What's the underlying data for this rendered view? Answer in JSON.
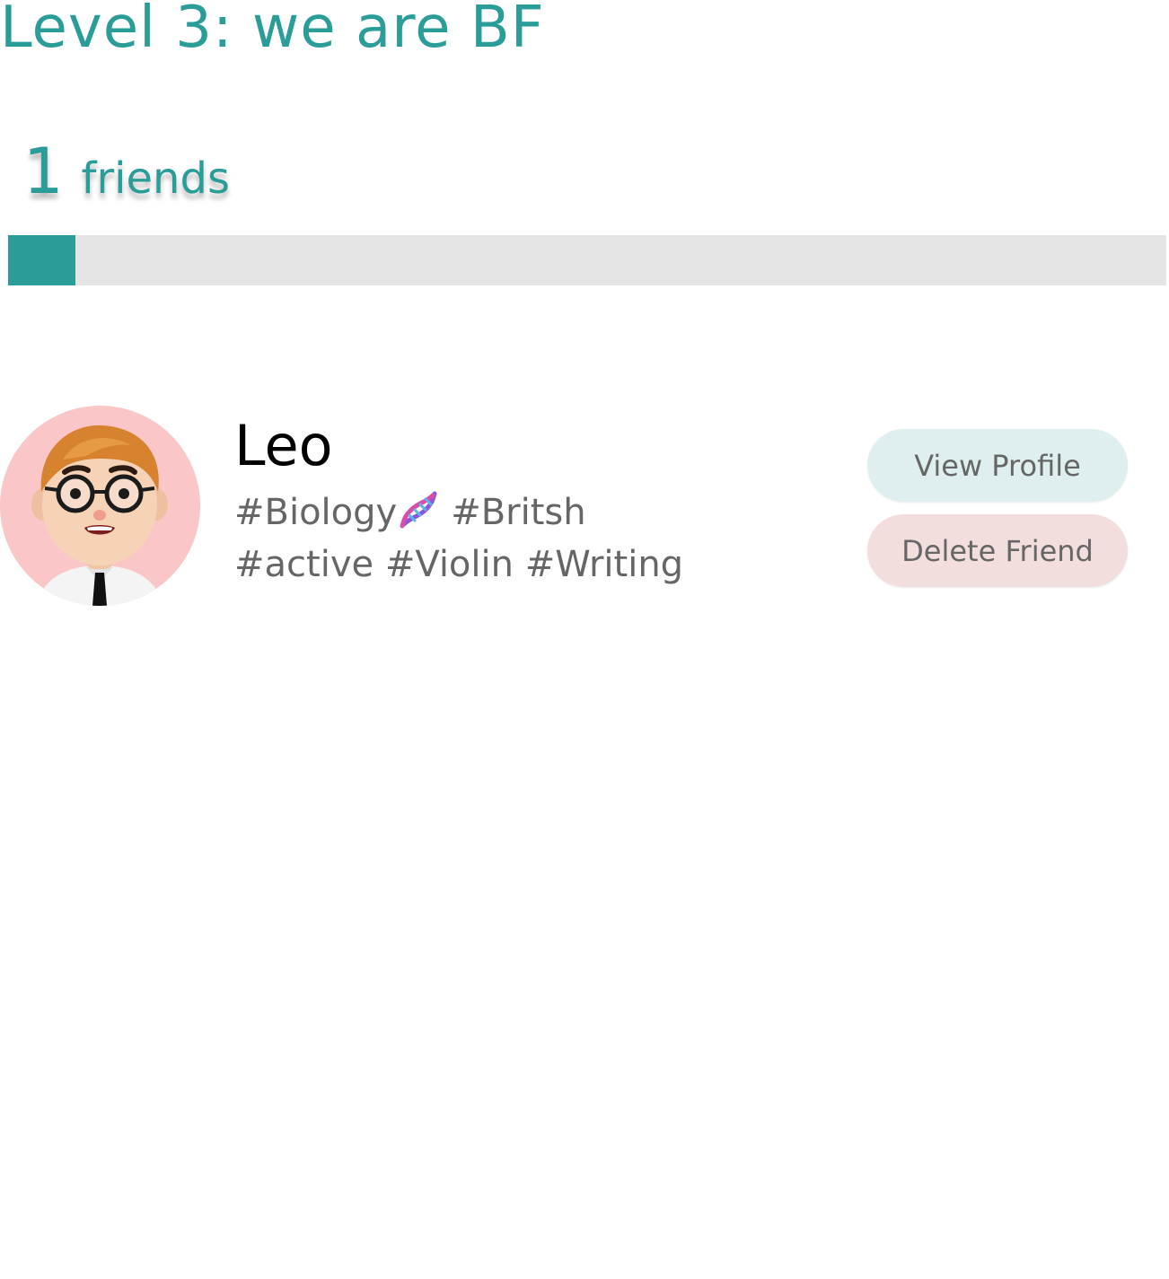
{
  "header": {
    "level_title": "Level 3: we are BF"
  },
  "friends_summary": {
    "count": "1",
    "label": "friends",
    "progress_fraction": 0.058
  },
  "friends": [
    {
      "name": "Leo",
      "tags_line1": "#Biology",
      "tags_line1_icon": "dna-icon",
      "tags_line1_rest": "#Britsh",
      "tags_line2": "#active #Violin #Writing",
      "avatar_icon": "avatar-cartoon-boy-icon",
      "view_label": "View Profile",
      "delete_label": "Delete Friend"
    }
  ],
  "colors": {
    "accent": "#2a9d98",
    "track": "#e5e5e5",
    "avatar_bg": "#fbc6c8",
    "view_button_bg": "#dfeeee",
    "delete_button_bg": "#f3dede",
    "secondary_text": "#666666"
  }
}
